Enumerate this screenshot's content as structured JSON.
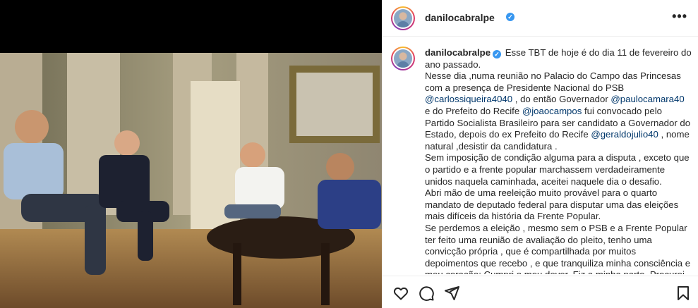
{
  "post": {
    "username": "danilocabralpe",
    "more_label": "•••"
  },
  "caption": {
    "username": "danilocabralpe",
    "p1": "Esse TBT de hoje é do dia 11 de fevereiro do ano passado.",
    "p2a": "Nesse dia ,numa reunião no Palacio do Campo das Princesas com a presença de Presidente Nacional do PSB ",
    "m1": "@carlossiqueira4040",
    "p2b": " , do então Governador ",
    "m2": "@paulocamara40",
    "p2c": " e do Prefeito do Recife ",
    "m3": "@joaocampos",
    "p2d": " fui convocado pelo Partido Socialista Brasileiro para ser candidato a Governador do Estado, depois do ex Prefeito do Recife ",
    "m4": "@geraldojulio40",
    "p2e": " , nome natural ,desistir da candidatura .",
    "p3": "Sem imposição de condição alguma para a disputa , exceto que o partido e a frente popular marchassem verdadeiramente unidos naquela caminhada, aceitei naquele dia o desafio.",
    "p4": "Abri mão de uma reeleição muito provável para o quarto mandato de deputado federal para disputar uma das eleições mais difíceis da história da Frente Popular.",
    "p5": "Se perdemos a eleição , mesmo sem o PSB e a Frente Popular ter feito uma reunião de avaliação do pleito, tenho uma convicção própria , que é compartilhada por muitos depoimentos que recebo , e que tranquiliza minha consciência e meu coração: Cumpri o meu dever. Fiz a minha parte. Procurei ser o melhor"
  },
  "icons": {
    "like": "heart-icon",
    "comment": "comment-icon",
    "share": "send-icon",
    "save": "bookmark-icon"
  },
  "colors": {
    "mention": "#00376b",
    "verified": "#3897f0",
    "text": "#262626"
  }
}
